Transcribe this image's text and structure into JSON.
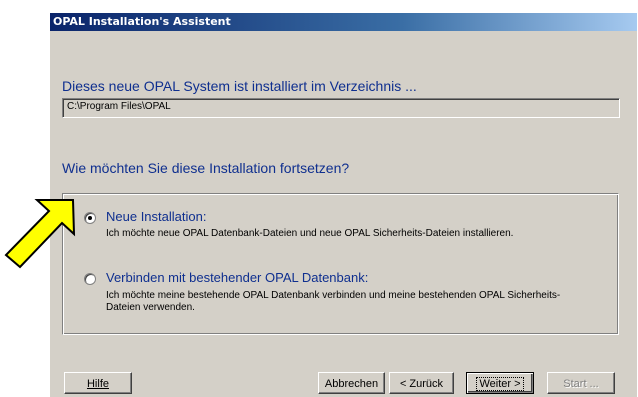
{
  "window": {
    "title": "OPAL Installation's Assistent"
  },
  "install_dir": {
    "heading": "Dieses neue OPAL System ist installiert im Verzeichnis ...",
    "path": "C:\\Program Files\\OPAL"
  },
  "continue_question": "Wie möchten Sie diese Installation fortsetzen?",
  "options": [
    {
      "label": "Neue Installation:",
      "description": "Ich möchte neue OPAL Datenbank-Dateien und neue OPAL Sicherheits-Dateien installieren.",
      "selected": true
    },
    {
      "label": "Verbinden mit bestehender OPAL Datenbank:",
      "description": "Ich möchte meine bestehende OPAL Datenbank verbinden und meine bestehenden OPAL Sicherheits-Dateien verwenden.",
      "selected": false
    }
  ],
  "buttons": {
    "help": "Hilfe",
    "cancel": "Abbrechen",
    "back": "< Zurück",
    "next": "Weiter >",
    "start": "Start ..."
  },
  "colors": {
    "accent_text": "#0f2f8f",
    "arrow_fill": "#ffff00",
    "titlebar": "#0a246a"
  },
  "icons": {
    "pointer": "yellow-arrow-icon"
  }
}
